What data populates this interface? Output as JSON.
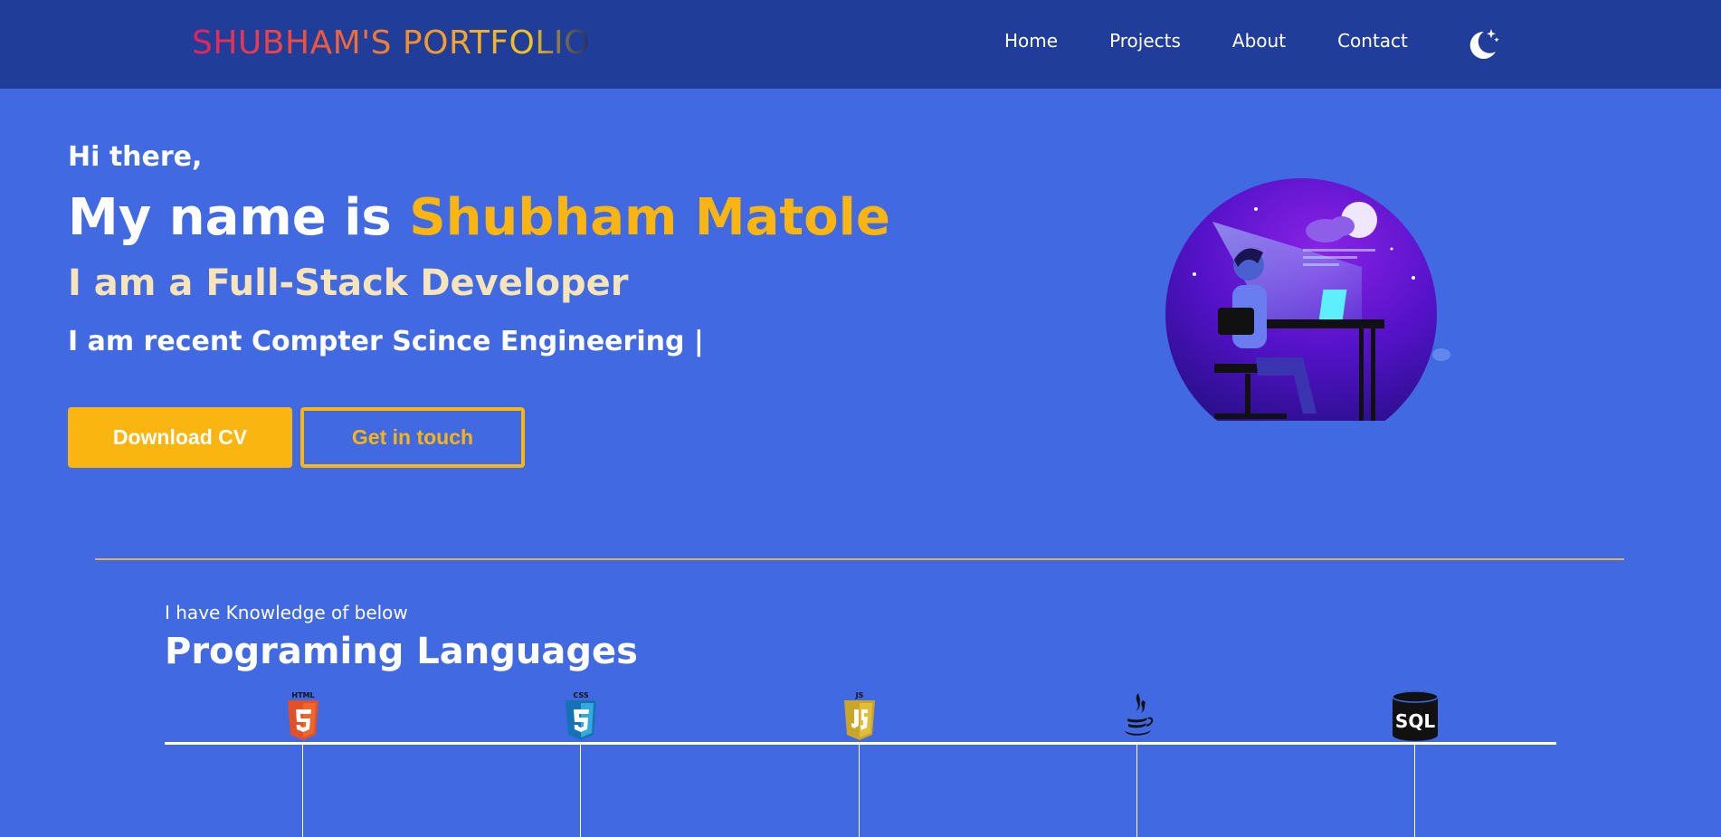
{
  "nav": {
    "brand": "SHUBHAM'S PORTFOLIO",
    "links": [
      "Home",
      "Projects",
      "About",
      "Contact"
    ],
    "theme_icon": "moon-stars-icon"
  },
  "hero": {
    "greeting": "Hi there,",
    "name_prefix": "My name is ",
    "name_highlight": "Shubham Matole",
    "role": "I am a Full-Stack Developer",
    "typing_text": "I am recent Compter Scince Engineering |",
    "download_label": "Download CV",
    "contact_label": "Get in touch",
    "illustration": "developer-at-desk-night-illustration"
  },
  "skills": {
    "subtitle": "I have Knowledge of below",
    "title": "Programing Languages",
    "items": [
      {
        "name": "HTML5",
        "icon": "html5-icon",
        "badge": "HTML"
      },
      {
        "name": "CSS3",
        "icon": "css3-icon",
        "badge": "CSS"
      },
      {
        "name": "JavaScript",
        "icon": "javascript-icon",
        "badge": "JS"
      },
      {
        "name": "Java",
        "icon": "java-icon"
      },
      {
        "name": "SQL",
        "icon": "sql-database-icon",
        "badge": "SQL"
      }
    ]
  },
  "colors": {
    "background": "#4169e1",
    "navbar": "#1f3d99",
    "accent": "#fbb511",
    "role_text": "#f7e4b8"
  }
}
